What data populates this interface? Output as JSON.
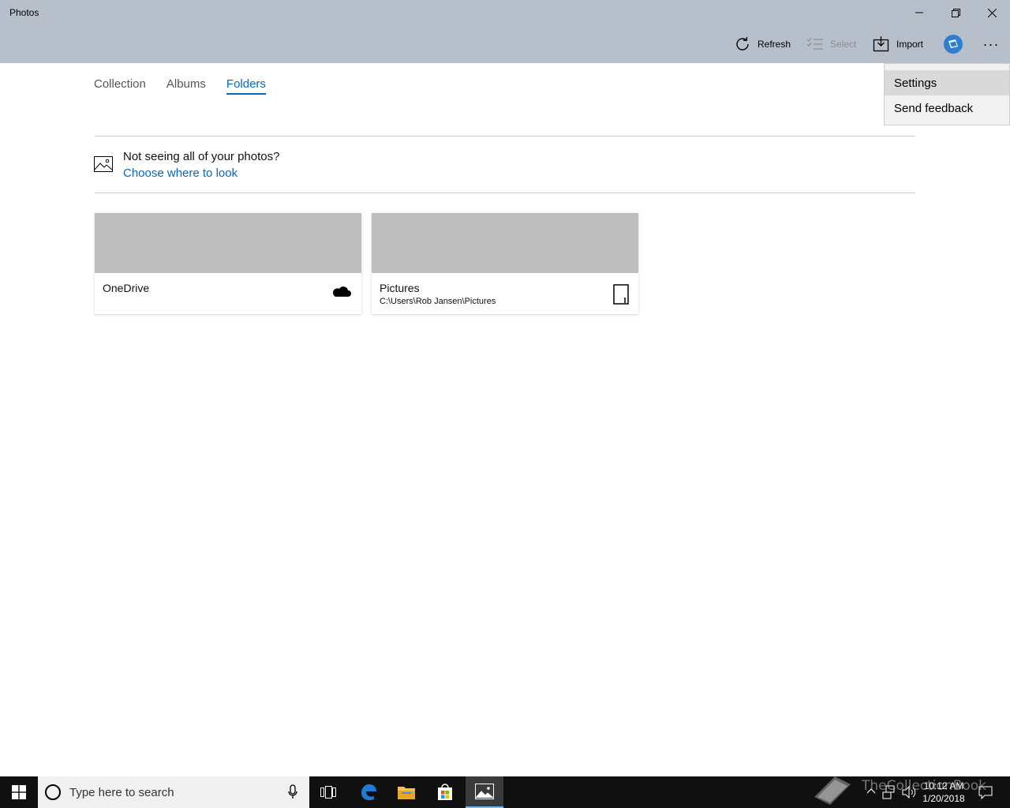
{
  "window": {
    "title": "Photos"
  },
  "toolbar": {
    "refresh_label": "Refresh",
    "select_label": "Select",
    "import_label": "Import",
    "more_label": "···"
  },
  "tabs": [
    {
      "label": "Collection",
      "active": false
    },
    {
      "label": "Albums",
      "active": false
    },
    {
      "label": "Folders",
      "active": true
    }
  ],
  "notice": {
    "question": "Not seeing all of your photos?",
    "link": "Choose where to look"
  },
  "folders": [
    {
      "name": "OneDrive",
      "path": "",
      "icon": "cloud-icon"
    },
    {
      "name": "Pictures",
      "path": "C:\\Users\\Rob Jansen\\Pictures",
      "icon": "device-icon"
    }
  ],
  "menu": {
    "items": [
      {
        "label": "Settings",
        "highlighted": true
      },
      {
        "label": "Send feedback",
        "highlighted": false
      }
    ]
  },
  "taskbar": {
    "search_placeholder": "Type here to search",
    "clock_time": "10:12 AM",
    "clock_date": "1/20/2018",
    "watermark": "TheCollectionBook"
  },
  "colors": {
    "titlebar": "#b6bfca",
    "accent": "#0a68b4",
    "tile_thumb": "#bdbdbd",
    "taskbar": "#101010"
  }
}
